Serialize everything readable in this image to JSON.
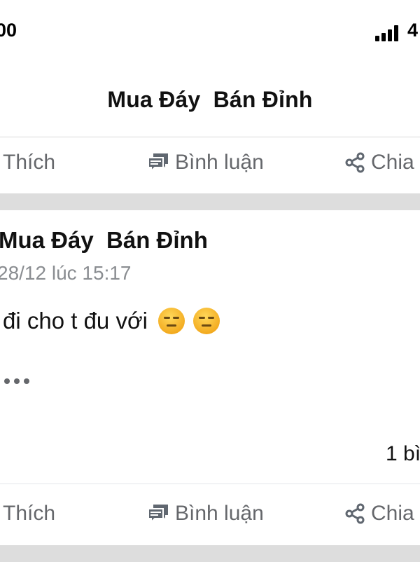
{
  "status_bar": {
    "time": "00",
    "battery": "4"
  },
  "header": {
    "title": "Mua Đáy  Bán Đỉnh"
  },
  "top_actions": {
    "like_label": "Thích",
    "comment_label": "Bình luận",
    "share_label": "Chia"
  },
  "post": {
    "author": "Mua Đáy  Bán Đỉnh",
    "timestamp": "28/12 lúc 15:17",
    "text": "đi cho t đu với",
    "emojis": [
      "expressionless-face-icon",
      "expressionless-face-icon"
    ],
    "comment_count": "1 bì"
  },
  "bottom_actions": {
    "like_label": "Thích",
    "comment_label": "Bình luận",
    "share_label": "Chia"
  },
  "colors": {
    "separator": "#dddddd",
    "secondary_text": "#65676b",
    "emoji_yellow": "#f7c33a"
  }
}
